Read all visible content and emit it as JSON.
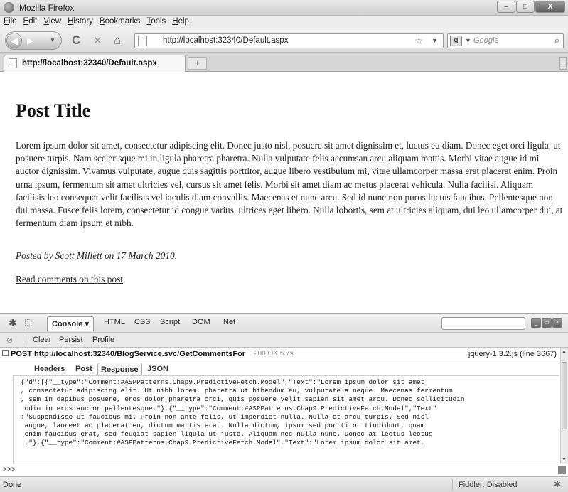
{
  "window": {
    "title": "Mozilla Firefox",
    "buttons": {
      "minimize": "–",
      "maximize": "□",
      "close": "X"
    }
  },
  "menu": [
    "File",
    "Edit",
    "View",
    "History",
    "Bookmarks",
    "Tools",
    "Help"
  ],
  "navigation": {
    "reload_glyph": "C",
    "stop_glyph": "✕",
    "home_glyph": "⌂",
    "url": "http://localhost:32340/Default.aspx",
    "bookmark_glyph": "☆",
    "search_placeholder": "Google",
    "search_glyph": "⌕"
  },
  "tabs": [
    {
      "title": "http://localhost:32340/Default.aspx",
      "active": true
    }
  ],
  "page": {
    "title": "Post Title",
    "body": "Lorem ipsum dolor sit amet, consectetur adipiscing elit. Donec justo nisl, posuere sit amet dignissim et, luctus eu diam. Donec eget orci ligula, ut posuere turpis. Nam scelerisque mi in ligula pharetra pharetra. Nulla vulputate felis accumsan arcu aliquam mattis. Morbi vitae augue id mi auctor dignissim. Vivamus vulputate, augue quis sagittis porttitor, augue libero vestibulum mi, vitae ullamcorper massa erat placerat enim. Proin urna ipsum, fermentum sit amet ultricies vel, cursus sit amet felis. Morbi sit amet diam ac metus placerat vehicula. Nulla facilisi. Aliquam facilisis leo consequat velit facilisis vel iaculis diam convallis. Maecenas et nunc arcu. Sed id nunc non purus luctus faucibus. Pellentesque non dui massa. Fusce felis lorem, consectetur id congue varius, ultrices eget libero. Nulla lobortis, sem at ultricies aliquam, dui leo ullamcorper dui, at fermentum diam ipsum et nibh.",
    "posted_by": "Posted by Scott Millett on 17 March 2010.",
    "read_comments_link": "Read comments on this post",
    "read_comments_suffix": "."
  },
  "firebug": {
    "tabs": [
      "Console",
      "HTML",
      "CSS",
      "Script",
      "DOM",
      "Net"
    ],
    "active_tab": "Console",
    "console_actions": [
      "Clear",
      "Persist",
      "Profile"
    ],
    "request": {
      "toggle": "−",
      "label": "POST http://localhost:32340/BlogService.svc/GetCommentsFor",
      "status": "200 OK 5.7s",
      "source": "jquery-1.3.2.js (line 3667)"
    },
    "request_tabs": [
      "Headers",
      "Post",
      "Response",
      "JSON"
    ],
    "active_request_tab": "Response",
    "response_lines": [
      "{\"d\":[{\"__type\":\"Comment:#ASPPatterns.Chap9.PredictiveFetch.Model\",\"Text\":\"Lorem ipsum dolor sit amet",
      ", consectetur adipiscing elit. Ut nibh lorem, pharetra ut bibendum eu, vulputate a neque. Maecenas fermentum",
      ", sem in dapibus posuere, eros dolor pharetra orci, quis posuere velit sapien sit amet arcu. Donec sollicitudin",
      " odio in eros auctor pellentesque.\"},{\"__type\":\"Comment:#ASPPatterns.Chap9.PredictiveFetch.Model\",\"Text\"",
      ":\"Suspendisse ut faucibus mi. Proin non ante felis, ut imperdiet nulla. Nulla et arcu turpis. Sed nisl",
      " augue, laoreet ac placerat eu, dictum mattis erat. Nulla dictum, ipsum sed porttitor tincidunt, quam",
      " enim faucibus erat, sed feugiat sapien ligula ut justo. Aliquam nec nulla nunc. Donec at lectus lectus",
      " .\"},{\"__type\":\"Comment:#ASPPatterns.Chap9.PredictiveFetch.Model\",\"Text\":\"Lorem ipsum dolor sit amet,"
    ],
    "command_prompt": ">>>"
  },
  "statusbar": {
    "text": "Done",
    "fiddler": "Fiddler: Disabled"
  }
}
